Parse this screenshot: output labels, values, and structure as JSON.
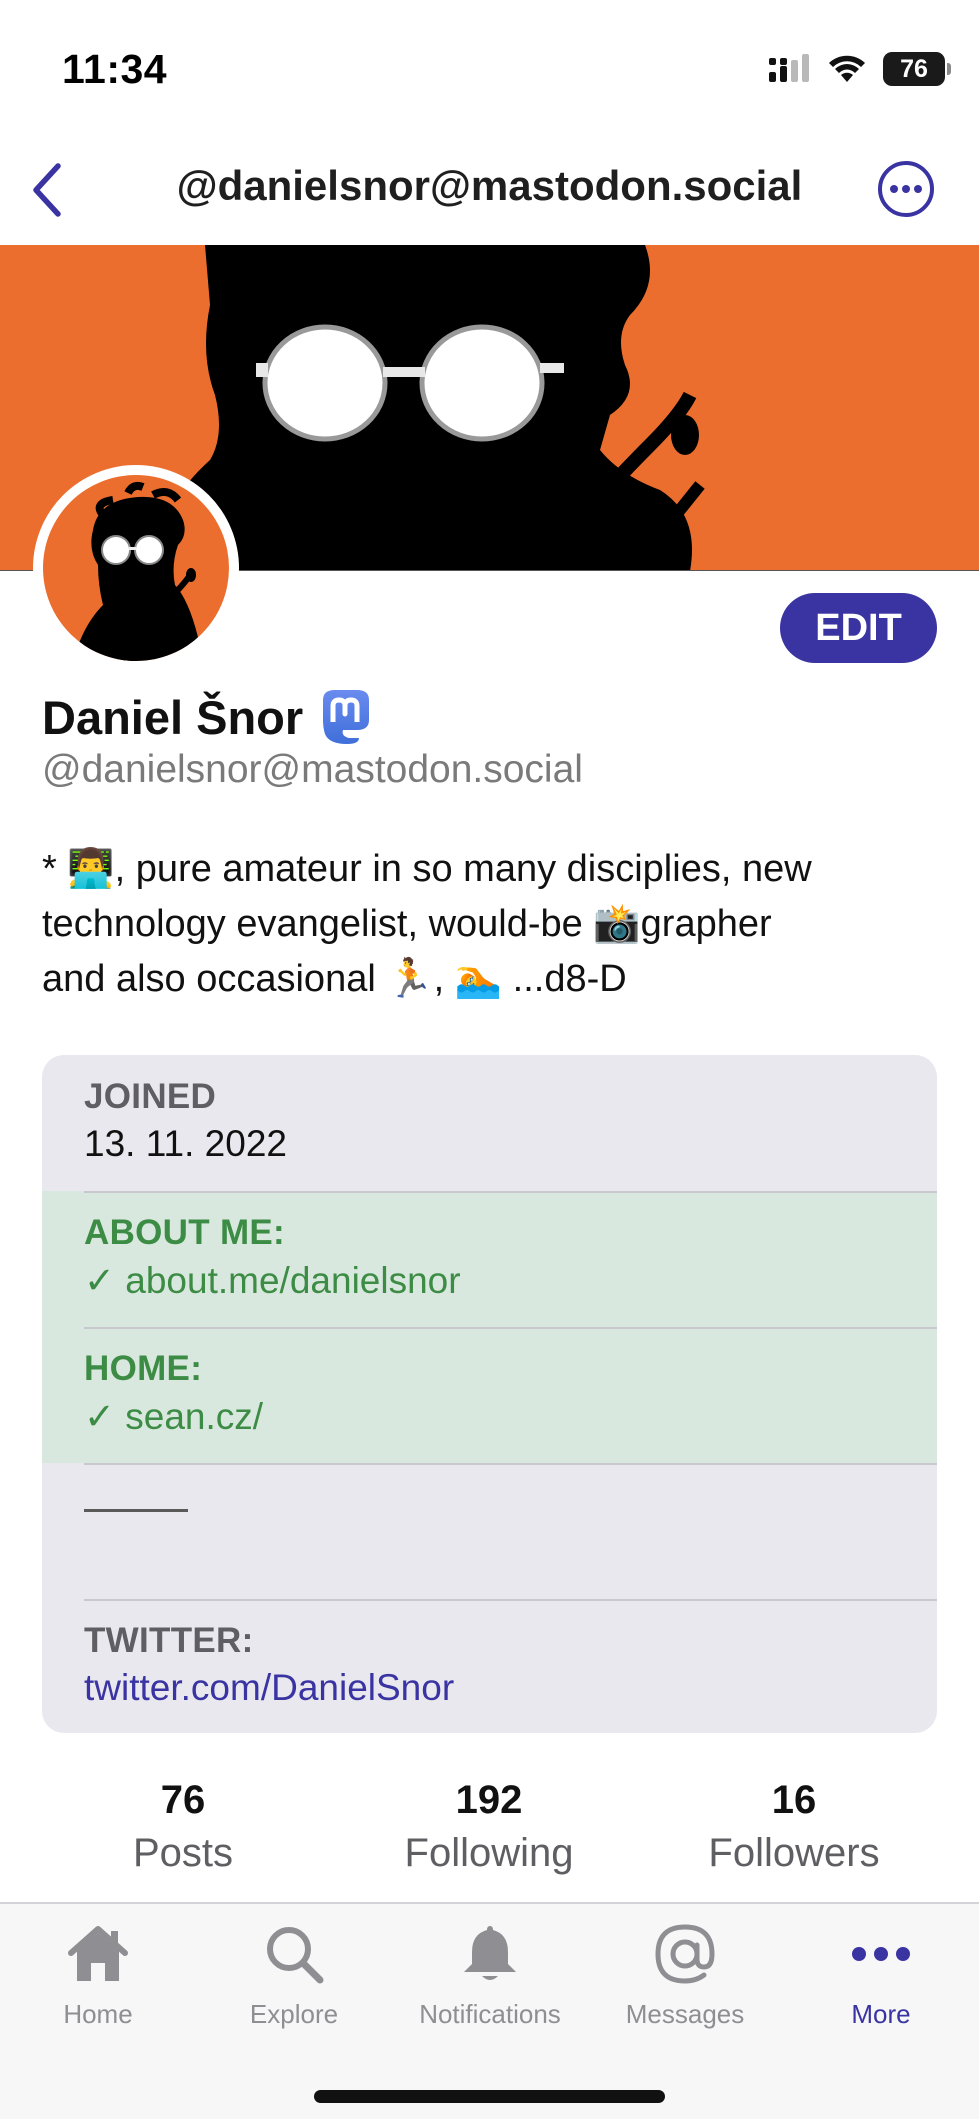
{
  "status_bar": {
    "time": "11:34",
    "battery": "76",
    "icons": [
      "cellular-signal-icon",
      "wifi-icon",
      "battery-icon"
    ]
  },
  "nav": {
    "title": "@danielsnor@mastodon.social",
    "back_icon": "chevron-left-icon",
    "more_icon": "ellipsis-circle-icon"
  },
  "profile": {
    "display_name": "Daniel Šnor",
    "handle": "@danielsnor@mastodon.social",
    "edit_label": "EDIT",
    "bio_line1": "* 👨‍💻, pure amateur in so many disciplies, new",
    "bio_line2": "technology evangelist, would-be 📸grapher",
    "bio_line3": "and also occasional 🏃, 🏊 ...d8-D"
  },
  "fields": {
    "joined_label": "JOINED",
    "joined_value": "13. 11. 2022",
    "about_label": "ABOUT ME:",
    "about_value": "✓ about.me/danielsnor",
    "home_label": "HOME:",
    "home_value": "✓ sean.cz/",
    "twitter_label": "TWITTER:",
    "twitter_value": "twitter.com/DanielSnor"
  },
  "stats": {
    "posts_count": "76",
    "posts_label": "Posts",
    "following_count": "192",
    "following_label": "Following",
    "followers_count": "16",
    "followers_label": "Followers"
  },
  "tabs": [
    {
      "label": "Home",
      "icon": "home-icon"
    },
    {
      "label": "Explore",
      "icon": "search-icon"
    },
    {
      "label": "Notifications",
      "icon": "bell-icon"
    },
    {
      "label": "Messages",
      "icon": "at-sign-icon"
    },
    {
      "label": "More",
      "icon": "more-dots-icon",
      "active": true
    }
  ],
  "colors": {
    "accent": "#3a34a3",
    "banner": "#ec6e2e",
    "verified": "#3d8c45",
    "verified_bg": "#d9e8df",
    "card_bg": "#e9e8ee"
  }
}
